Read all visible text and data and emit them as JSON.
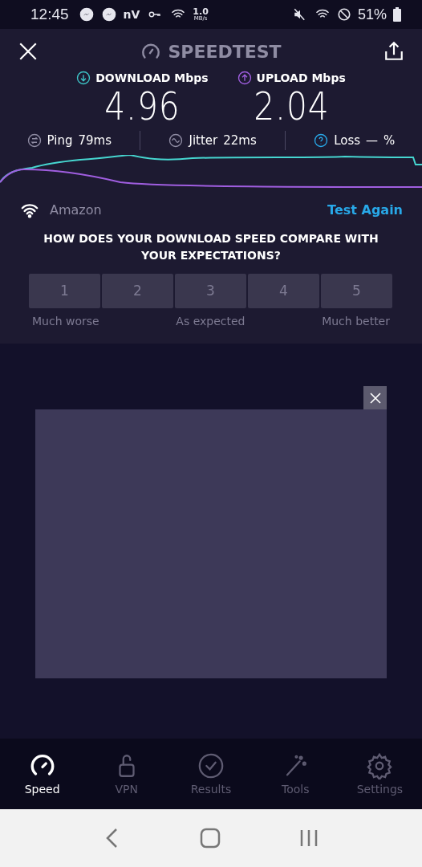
{
  "status_bar": {
    "time": "12:45",
    "carrier_text": "nV",
    "speed_value": "1.0",
    "speed_unit": "MB/s",
    "battery": "51%"
  },
  "header": {
    "title": "SPEEDTEST"
  },
  "results": [
    {
      "kind": "download",
      "label": "DOWNLOAD Mbps",
      "value": "4.96"
    },
    {
      "kind": "upload",
      "label": "UPLOAD Mbps",
      "value": "2.04"
    }
  ],
  "metrics": [
    {
      "kind": "ping",
      "label": "Ping",
      "value": "79ms"
    },
    {
      "kind": "jitter",
      "label": "Jitter",
      "value": "22ms"
    },
    {
      "kind": "loss",
      "label": "Loss",
      "value": "—",
      "unit": "%"
    }
  ],
  "network": {
    "name": "Amazon",
    "action": "Test Again"
  },
  "survey": {
    "question": "HOW DOES YOUR DOWNLOAD SPEED COMPARE WITH YOUR EXPECTATIONS?",
    "options": [
      {
        "label": "1",
        "selected": false
      },
      {
        "label": "2",
        "selected": false
      },
      {
        "label": "3",
        "selected": false
      },
      {
        "label": "4",
        "selected": false
      },
      {
        "label": "5",
        "selected": false
      }
    ],
    "scale_labels": [
      "Much worse",
      "As expected",
      "Much better"
    ]
  },
  "nav": [
    {
      "kind": "speed",
      "label": "Speed",
      "selected": true
    },
    {
      "kind": "vpn",
      "label": "VPN",
      "selected": false
    },
    {
      "kind": "results",
      "label": "Results",
      "selected": false
    },
    {
      "kind": "tools",
      "label": "Tools",
      "selected": false
    },
    {
      "kind": "settings",
      "label": "Settings",
      "selected": false
    }
  ]
}
